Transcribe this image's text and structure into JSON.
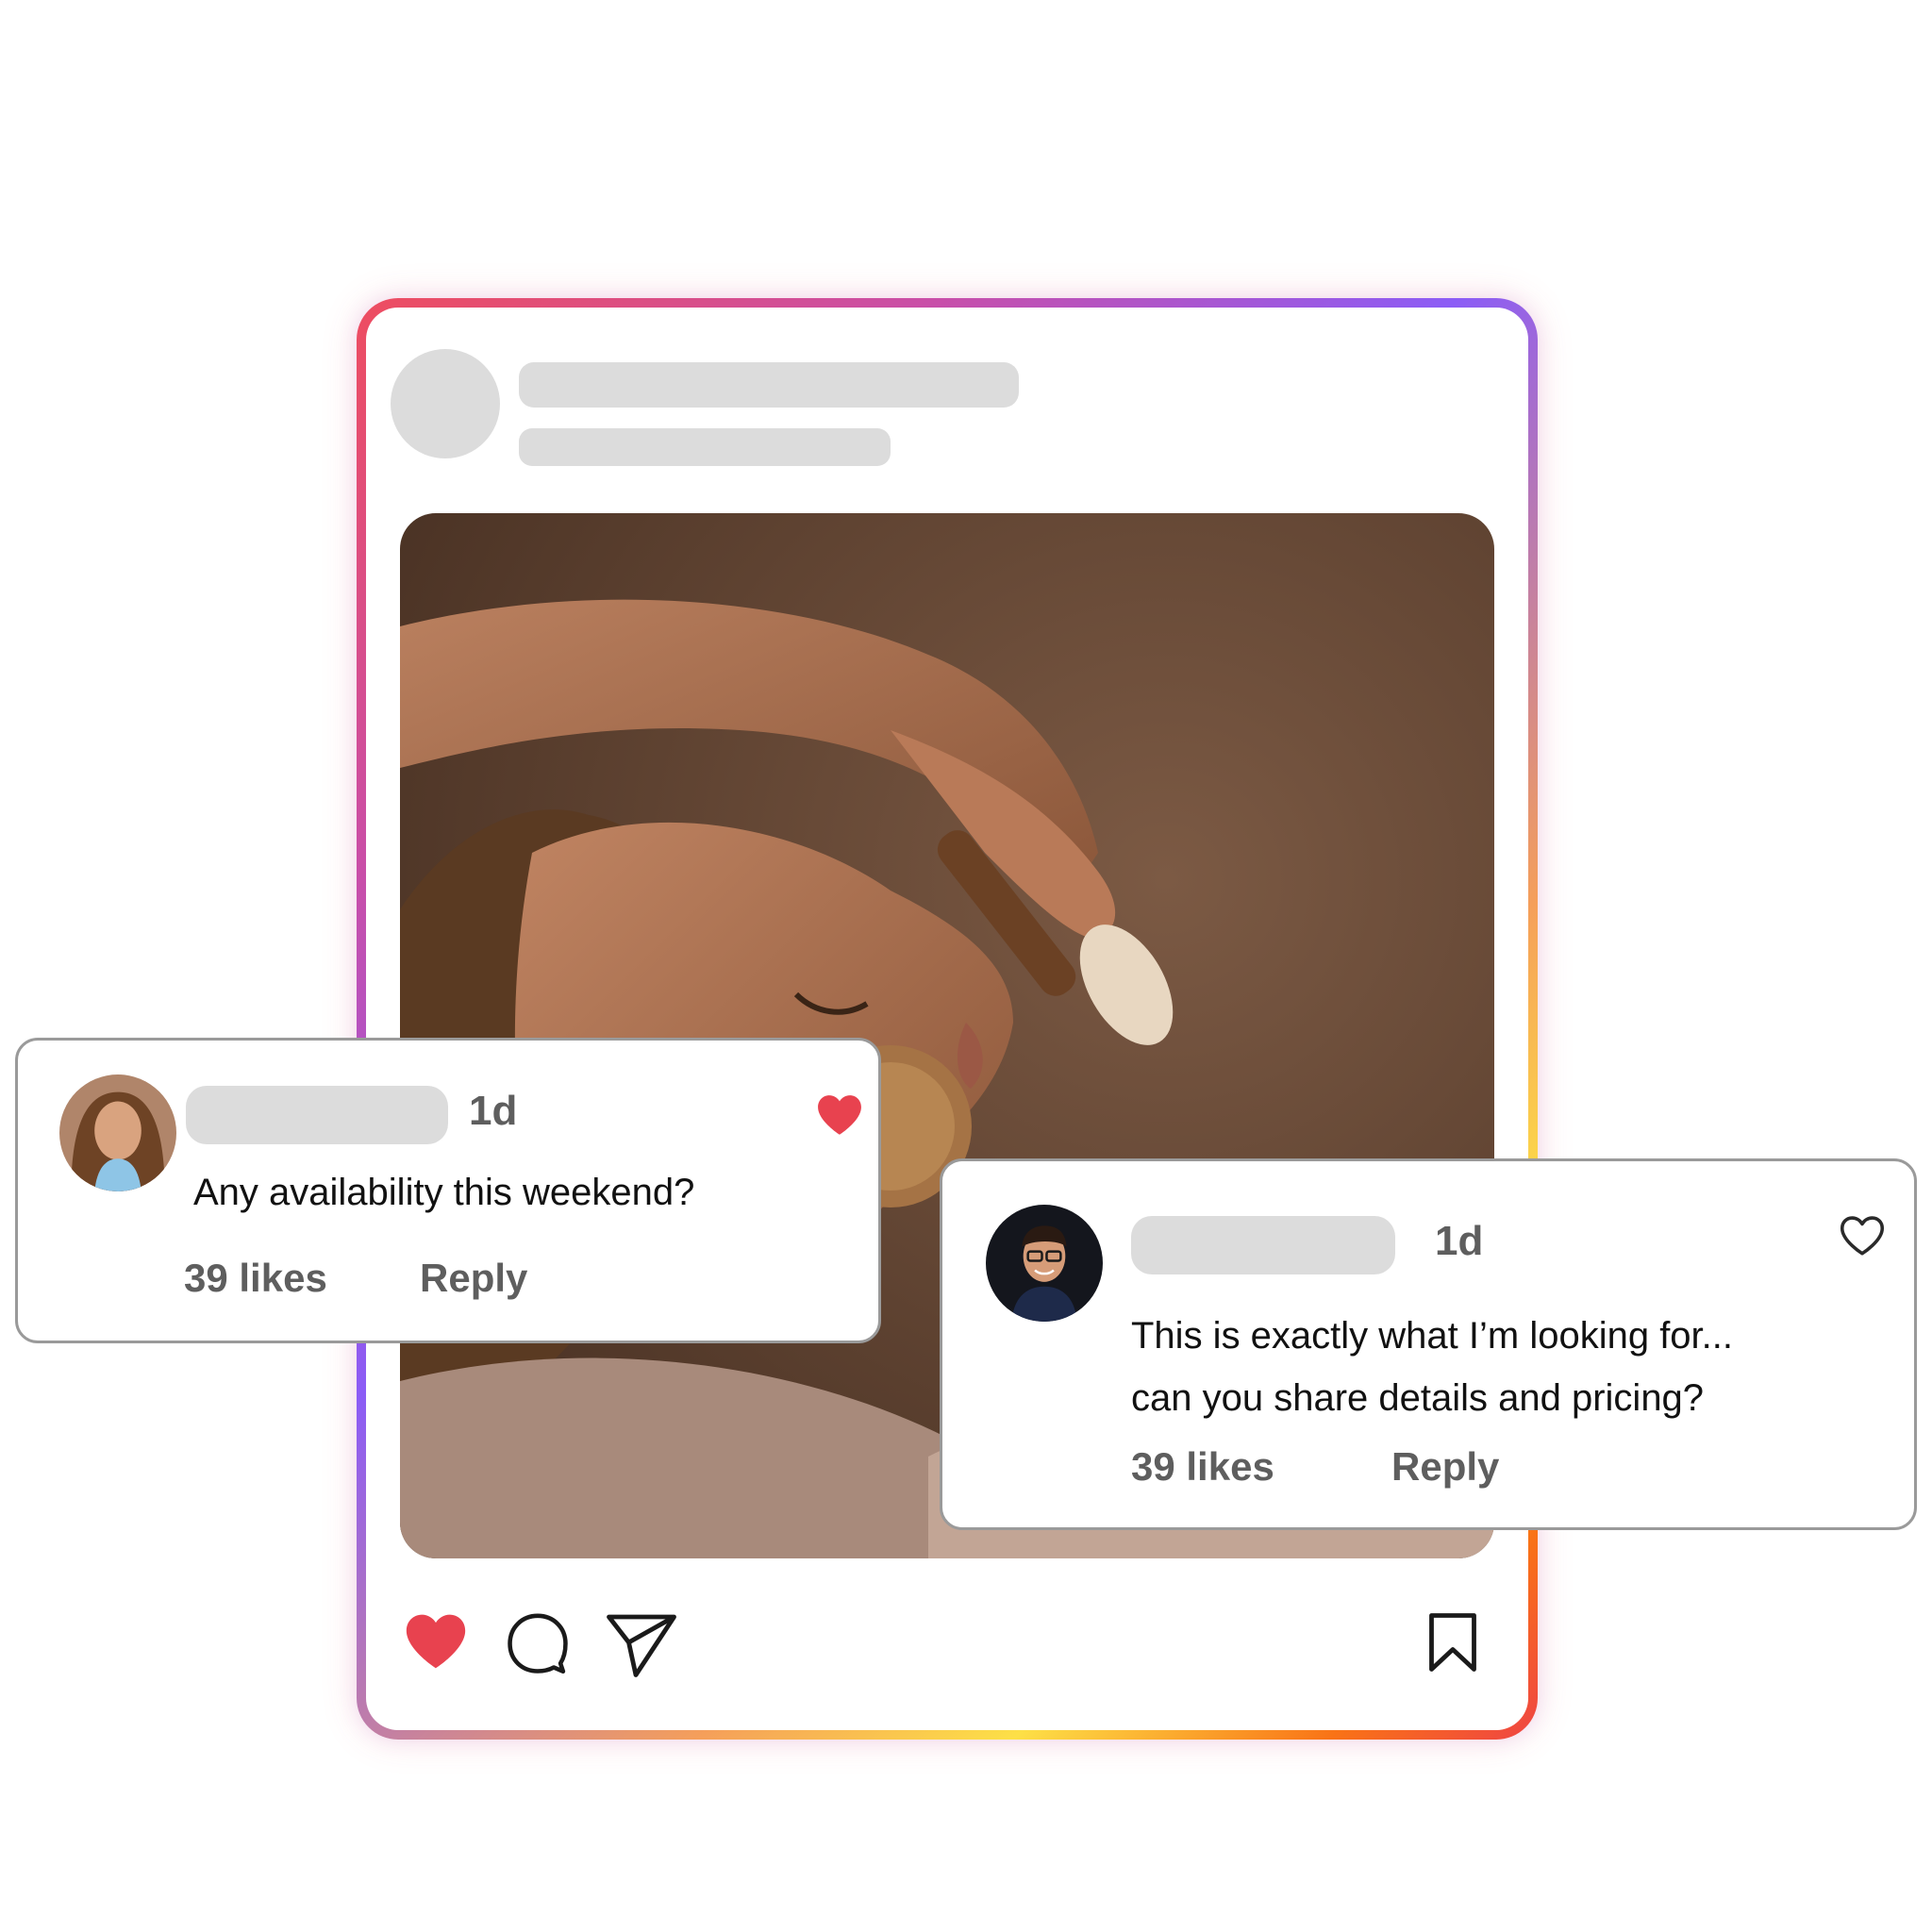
{
  "post": {
    "image_icon": "spa-facial-photo",
    "actions": {
      "like_icon": "heart-filled-icon",
      "comment_icon": "comment-bubble-icon",
      "share_icon": "paper-plane-icon",
      "save_icon": "bookmark-icon"
    }
  },
  "comments": [
    {
      "time": "1d",
      "text": "Any availability this weekend?",
      "likes": "39 likes",
      "reply": "Reply",
      "liked": true
    },
    {
      "time": "1d",
      "text_line1": "This is exactly what I’m looking for...",
      "text_line2": "can you share details and pricing?",
      "likes": "39 likes",
      "reply": "Reply",
      "liked": false
    }
  ],
  "colors": {
    "like_red": "#e8424f",
    "placeholder_gray": "#dcdcdc",
    "meta_gray": "#5e5e5e",
    "frame_gradient": [
      "#ee4d5f",
      "#8b5cf6",
      "#fde047",
      "#ef4444"
    ]
  }
}
